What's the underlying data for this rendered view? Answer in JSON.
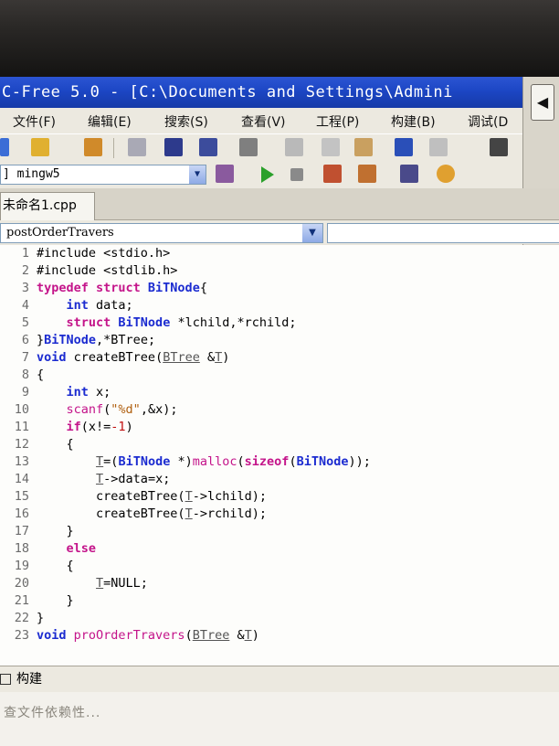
{
  "window": {
    "title": "C-Free 5.0 - [C:\\Documents and Settings\\Admini"
  },
  "menu": [
    {
      "label": "文件(F)"
    },
    {
      "label": "编辑(E)"
    },
    {
      "label": "搜索(S)"
    },
    {
      "label": "查看(V)"
    },
    {
      "label": "工程(P)"
    },
    {
      "label": "构建(B)"
    },
    {
      "label": "调试(D"
    }
  ],
  "compiler": {
    "selected": "] mingw5"
  },
  "tab": {
    "label": "未命名1.cpp"
  },
  "function_selector": {
    "selected": "postOrderTravers"
  },
  "code": [
    {
      "n": "1",
      "parts": [
        {
          "t": "#include <stdio.h>",
          "c": "pre"
        }
      ]
    },
    {
      "n": "2",
      "parts": [
        {
          "t": "#include <stdlib.h>",
          "c": "pre"
        }
      ]
    },
    {
      "n": "3",
      "parts": [
        {
          "t": "typedef struct ",
          "c": "kw"
        },
        {
          "t": "BiTNode",
          "c": "ty"
        },
        {
          "t": "{",
          "c": ""
        }
      ]
    },
    {
      "n": "4",
      "parts": [
        {
          "t": "    ",
          "c": ""
        },
        {
          "t": "int",
          "c": "ty"
        },
        {
          "t": " data;",
          "c": ""
        }
      ]
    },
    {
      "n": "5",
      "parts": [
        {
          "t": "    ",
          "c": ""
        },
        {
          "t": "struct ",
          "c": "kw"
        },
        {
          "t": "BiTNode",
          "c": "ty"
        },
        {
          "t": " *lchild,*rchild;",
          "c": ""
        }
      ]
    },
    {
      "n": "6",
      "parts": [
        {
          "t": "}",
          "c": ""
        },
        {
          "t": "BiTNode",
          "c": "ty"
        },
        {
          "t": ",*BTree;",
          "c": ""
        }
      ]
    },
    {
      "n": "7",
      "parts": [
        {
          "t": "void",
          "c": "ty"
        },
        {
          "t": " createBTree",
          "c": ""
        },
        {
          "t": "(",
          "c": ""
        },
        {
          "t": "BTree",
          "c": "u"
        },
        {
          "t": " &",
          "c": ""
        },
        {
          "t": "T",
          "c": "u"
        },
        {
          "t": ")",
          "c": ""
        }
      ]
    },
    {
      "n": "8",
      "parts": [
        {
          "t": "{",
          "c": ""
        }
      ]
    },
    {
      "n": "9",
      "parts": [
        {
          "t": "    ",
          "c": ""
        },
        {
          "t": "int",
          "c": "ty"
        },
        {
          "t": " x;",
          "c": ""
        }
      ]
    },
    {
      "n": "10",
      "parts": [
        {
          "t": "    ",
          "c": ""
        },
        {
          "t": "scanf",
          "c": "fn"
        },
        {
          "t": "(",
          "c": ""
        },
        {
          "t": "\"%d\"",
          "c": "str"
        },
        {
          "t": ",&x);",
          "c": ""
        }
      ]
    },
    {
      "n": "11",
      "parts": [
        {
          "t": "    ",
          "c": ""
        },
        {
          "t": "if",
          "c": "kw"
        },
        {
          "t": "(x!=",
          "c": ""
        },
        {
          "t": "-1",
          "c": "num"
        },
        {
          "t": ")",
          "c": ""
        }
      ]
    },
    {
      "n": "12",
      "parts": [
        {
          "t": "    {",
          "c": ""
        }
      ]
    },
    {
      "n": "13",
      "parts": [
        {
          "t": "        ",
          "c": ""
        },
        {
          "t": "T",
          "c": "u"
        },
        {
          "t": "=(",
          "c": ""
        },
        {
          "t": "BiTNode",
          "c": "ty"
        },
        {
          "t": " *)",
          "c": ""
        },
        {
          "t": "malloc",
          "c": "fn"
        },
        {
          "t": "(",
          "c": ""
        },
        {
          "t": "sizeof",
          "c": "kw"
        },
        {
          "t": "(",
          "c": ""
        },
        {
          "t": "BiTNode",
          "c": "ty"
        },
        {
          "t": "));",
          "c": ""
        }
      ]
    },
    {
      "n": "14",
      "parts": [
        {
          "t": "        ",
          "c": ""
        },
        {
          "t": "T",
          "c": "u"
        },
        {
          "t": "->data=x;",
          "c": ""
        }
      ]
    },
    {
      "n": "15",
      "parts": [
        {
          "t": "        createBTree(",
          "c": ""
        },
        {
          "t": "T",
          "c": "u"
        },
        {
          "t": "->lchild);",
          "c": ""
        }
      ]
    },
    {
      "n": "16",
      "parts": [
        {
          "t": "        createBTree(",
          "c": ""
        },
        {
          "t": "T",
          "c": "u"
        },
        {
          "t": "->rchild);",
          "c": ""
        }
      ]
    },
    {
      "n": "17",
      "parts": [
        {
          "t": "    }",
          "c": ""
        }
      ]
    },
    {
      "n": "18",
      "parts": [
        {
          "t": "    ",
          "c": ""
        },
        {
          "t": "else",
          "c": "kw"
        }
      ]
    },
    {
      "n": "19",
      "parts": [
        {
          "t": "    {",
          "c": ""
        }
      ]
    },
    {
      "n": "20",
      "parts": [
        {
          "t": "        ",
          "c": ""
        },
        {
          "t": "T",
          "c": "u"
        },
        {
          "t": "=NULL;",
          "c": ""
        }
      ]
    },
    {
      "n": "21",
      "parts": [
        {
          "t": "    }",
          "c": ""
        }
      ]
    },
    {
      "n": "22",
      "parts": [
        {
          "t": "}",
          "c": ""
        }
      ]
    },
    {
      "n": "23",
      "parts": [
        {
          "t": "void",
          "c": "ty"
        },
        {
          "t": " proOrderTravers",
          "c": "fn"
        },
        {
          "t": "(",
          "c": ""
        },
        {
          "t": "BTree",
          "c": "u"
        },
        {
          "t": " &",
          "c": ""
        },
        {
          "t": "T",
          "c": "u"
        },
        {
          "t": ")",
          "c": ""
        }
      ]
    }
  ],
  "build_panel": {
    "label": "构建"
  },
  "output": {
    "text": "查文件依赖性..."
  },
  "colors": {
    "titlebar": "#1c46c4",
    "keyword": "#c4148a",
    "type": "#1b2bd0",
    "string": "#b06010",
    "number": "#c01010"
  }
}
